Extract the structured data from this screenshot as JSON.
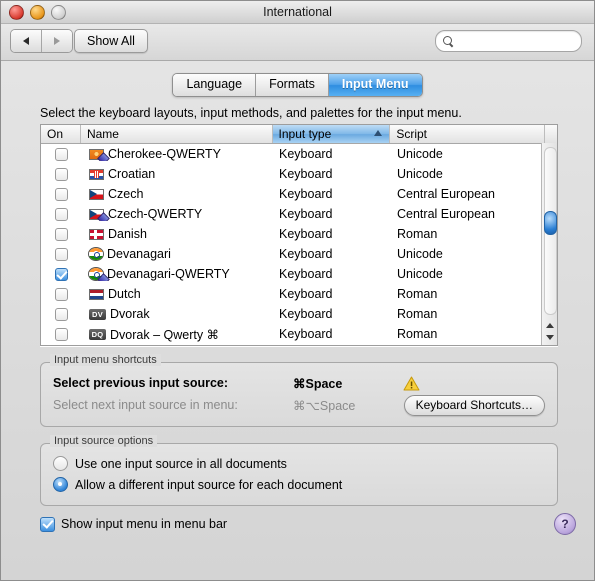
{
  "window": {
    "title": "International",
    "traffic_lights": [
      "close-button",
      "minimize-button",
      "zoom-button"
    ]
  },
  "toolbar": {
    "back_label": "◀",
    "forward_label": "▶",
    "show_all_label": "Show All",
    "search_value": "",
    "search_placeholder": ""
  },
  "tabs": [
    {
      "label": "Language",
      "active": false
    },
    {
      "label": "Formats",
      "active": false
    },
    {
      "label": "Input Menu",
      "active": true
    }
  ],
  "instruction": "Select the keyboard layouts, input methods, and palettes for the input menu.",
  "table": {
    "columns": [
      "On",
      "Name",
      "Input type",
      "Script"
    ],
    "sorted_column": "Input type",
    "sort_direction": "ascending",
    "rows": [
      {
        "on": false,
        "name": "Cherokee-QWERTY",
        "type": "Keyboard",
        "script": "Unicode",
        "icon": "flag-cherokee",
        "qwerty_badge": true
      },
      {
        "on": false,
        "name": "Croatian",
        "type": "Keyboard",
        "script": "Unicode",
        "icon": "flag-croatia",
        "qwerty_badge": false
      },
      {
        "on": false,
        "name": "Czech",
        "type": "Keyboard",
        "script": "Central European",
        "icon": "flag-czech",
        "qwerty_badge": false
      },
      {
        "on": false,
        "name": "Czech-QWERTY",
        "type": "Keyboard",
        "script": "Central European",
        "icon": "flag-czech",
        "qwerty_badge": true
      },
      {
        "on": false,
        "name": "Danish",
        "type": "Keyboard",
        "script": "Roman",
        "icon": "flag-denmark",
        "qwerty_badge": false
      },
      {
        "on": false,
        "name": "Devanagari",
        "type": "Keyboard",
        "script": "Unicode",
        "icon": "flag-india",
        "qwerty_badge": false
      },
      {
        "on": true,
        "name": "Devanagari-QWERTY",
        "type": "Keyboard",
        "script": "Unicode",
        "icon": "flag-india",
        "qwerty_badge": true
      },
      {
        "on": false,
        "name": "Dutch",
        "type": "Keyboard",
        "script": "Roman",
        "icon": "flag-netherlands",
        "qwerty_badge": false
      },
      {
        "on": false,
        "name": "Dvorak",
        "type": "Keyboard",
        "script": "Roman",
        "icon": "badge-dv",
        "badge_text": "DV",
        "qwerty_badge": false
      },
      {
        "on": false,
        "name": "Dvorak – Qwerty ⌘",
        "type": "Keyboard",
        "script": "Roman",
        "icon": "badge-dq",
        "badge_text": "DQ",
        "qwerty_badge": false
      }
    ]
  },
  "shortcuts_group": {
    "title": "Input menu shortcuts",
    "rows": [
      {
        "label": "Select previous input source:",
        "key": "⌘Space",
        "dim": false
      },
      {
        "label": "Select next input source in menu:",
        "key": "⌘⌥Space",
        "dim": true
      }
    ],
    "warning_icon": "warning-triangle-icon",
    "button_label": "Keyboard Shortcuts…"
  },
  "options_group": {
    "title": "Input source options",
    "options": [
      {
        "label": "Use one input source in all documents",
        "selected": false
      },
      {
        "label": "Allow a different input source for each document",
        "selected": true
      }
    ]
  },
  "footer": {
    "checkbox_label": "Show input menu in menu bar",
    "checkbox_checked": true,
    "help_label": "?"
  },
  "colors": {
    "accent_blue": "#3c90e0",
    "tab_active": "#2f8ee0",
    "header_sort": "#7fb8e8",
    "warning_yellow": "#f5c233",
    "help_purple": "#b9a4dc"
  }
}
